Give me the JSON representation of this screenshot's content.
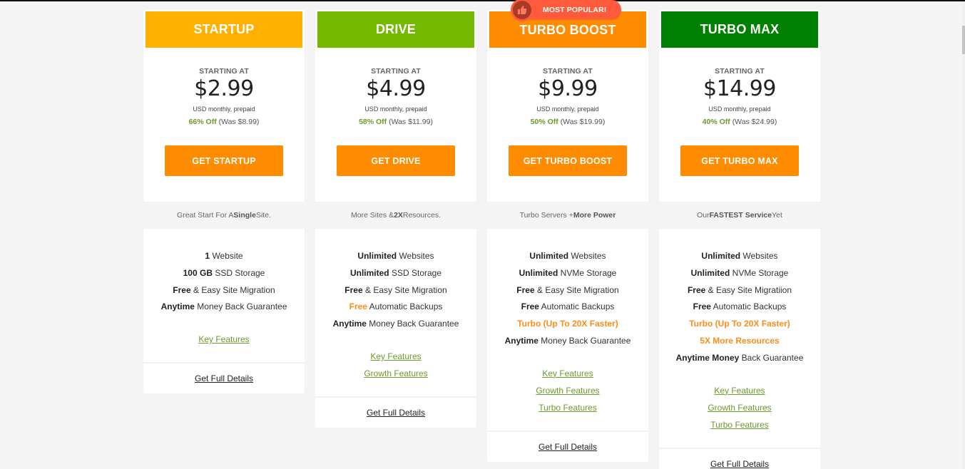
{
  "colors": {
    "startup": "#ffb000",
    "drive": "#74b800",
    "turbo_boost": "#ff8c00",
    "turbo_max": "#008000",
    "cta": "#ff8c00",
    "discount_green": "#6d9a2c",
    "badge": "#ff5a3c"
  },
  "badge": {
    "label": "MOST POPULAR!",
    "icon": "thumbs-up-icon"
  },
  "plans": [
    {
      "name": "STARTUP",
      "starting_label": "STARTING AT",
      "price": "$2.99",
      "period": "USD monthly, prepaid",
      "discount": "66% Off",
      "was": "(Was $8.99)",
      "cta": "GET STARTUP",
      "tagline": {
        "pre": "Great Start For A ",
        "bold": "Single",
        "post": " Site."
      },
      "features": [
        {
          "bold": "1",
          "text": " Website"
        },
        {
          "bold": "100 GB",
          "text": " SSD Storage"
        },
        {
          "bold": "Free",
          "text": " & Easy Site Migration"
        },
        {
          "bold": "Anytime",
          "text": " Money Back Guarantee"
        }
      ],
      "links": [
        "Key Features"
      ],
      "details": "Get Full Details"
    },
    {
      "name": "DRIVE",
      "starting_label": "STARTING AT",
      "price": "$4.99",
      "period": "USD monthly, prepaid",
      "discount": "58% Off",
      "was": "(Was $11.99)",
      "cta": "GET DRIVE",
      "tagline": {
        "pre": "More Sites & ",
        "bold": "2X",
        "post": " Resources."
      },
      "features": [
        {
          "bold": "Unlimited",
          "text": " Websites"
        },
        {
          "bold": "Unlimited",
          "text": " SSD Storage"
        },
        {
          "bold": "Free",
          "text": " & Easy Site Migration"
        },
        {
          "highlight": "Free",
          "text": " Automatic Backups"
        },
        {
          "bold": "Anytime",
          "text": " Money Back Guarantee"
        }
      ],
      "links": [
        "Key Features",
        "Growth Features"
      ],
      "details": "Get Full Details"
    },
    {
      "name": "TURBO BOOST",
      "starting_label": "STARTING AT",
      "price": "$9.99",
      "period": "USD monthly, prepaid",
      "discount": "50% Off",
      "was": "(Was $19.99)",
      "cta": "GET TURBO BOOST",
      "tagline": {
        "pre": "Turbo Servers + ",
        "bold": "More Power",
        "post": ""
      },
      "features": [
        {
          "bold": "Unlimited",
          "text": " Websites"
        },
        {
          "bold": "Unlimited",
          "text": " NVMe Storage"
        },
        {
          "bold": "Free",
          "text": " & Easy Site Migration"
        },
        {
          "bold": "Free",
          "text": " Automatic Backups"
        },
        {
          "orange": "Turbo (Up To 20X Faster)"
        },
        {
          "bold": "Anytime",
          "text": " Money Back Guarantee"
        }
      ],
      "links": [
        "Key Features",
        "Growth Features",
        "Turbo Features"
      ],
      "details": "Get Full Details"
    },
    {
      "name": "TURBO MAX",
      "starting_label": "STARTING AT",
      "price": "$14.99",
      "period": "USD monthly, prepaid",
      "discount": "40% Off",
      "was": "(Was $24.99)",
      "cta": "GET TURBO MAX",
      "tagline": {
        "pre": "Our ",
        "bold": "FASTEST Service",
        "post": " Yet"
      },
      "features": [
        {
          "bold": "Unlimited",
          "text": " Websites"
        },
        {
          "bold": "Unlimited",
          "text": " NVMe Storage"
        },
        {
          "bold": "Free",
          "text": " & Easy Site Migratiion"
        },
        {
          "bold": "Free",
          "text": " Automatic Backups"
        },
        {
          "orange": "Turbo (Up To 20X Faster)"
        },
        {
          "orange": "5X More Resources"
        },
        {
          "bold": "Anytime Money",
          "text": " Back Guarantee"
        }
      ],
      "links": [
        "Key Features",
        "Growth Features",
        "Turbo Features"
      ],
      "details": "Get Full Details"
    }
  ]
}
